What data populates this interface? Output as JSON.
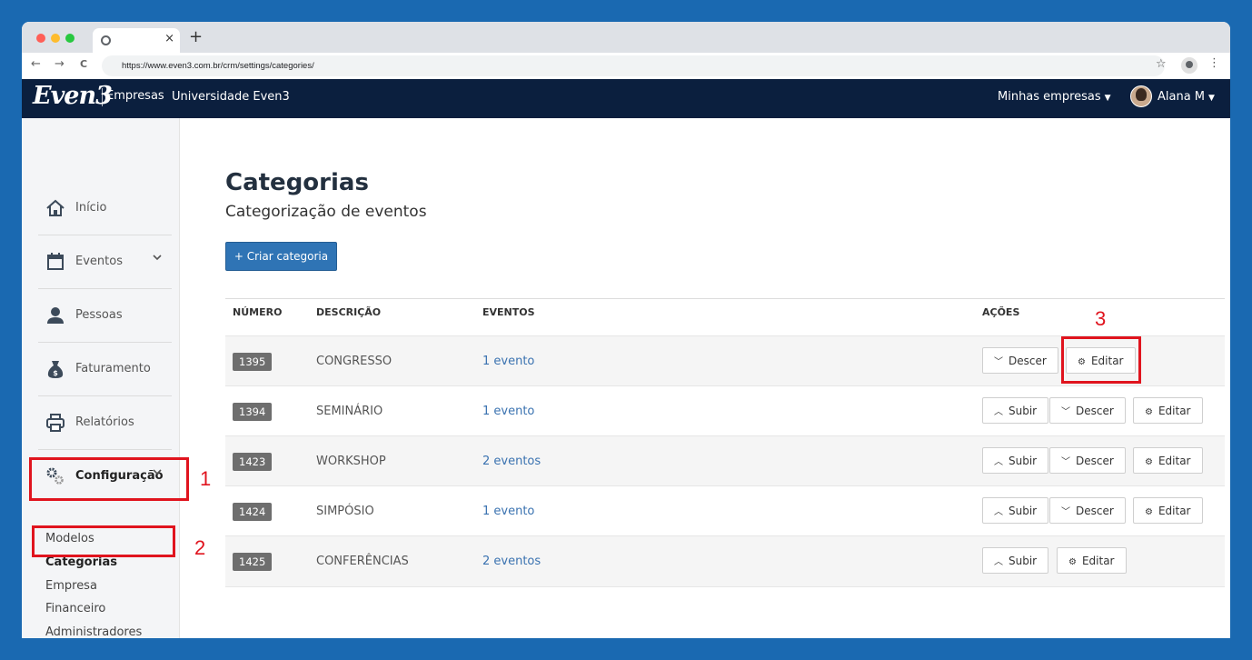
{
  "browser": {
    "url": "https://www.even3.com.br/crm/settings/categories/",
    "tab_close": "×",
    "new_tab": "+",
    "back": "←",
    "forward": "→",
    "reload": "C",
    "star": "☆",
    "kebab": "⋮",
    "dot_colors": [
      "#ff5f57",
      "#febc2e",
      "#28c840"
    ]
  },
  "header": {
    "logo": "Even3",
    "brand_sub": "Empresas",
    "org": "Universidade Even3",
    "menu_companies": "Minhas empresas",
    "user": "Alana M",
    "caret": "▼"
  },
  "sidebar": {
    "items": [
      {
        "label": "Início",
        "icon": "home-icon"
      },
      {
        "label": "Eventos",
        "icon": "calendar-icon"
      },
      {
        "label": "Pessoas",
        "icon": "person-icon"
      },
      {
        "label": "Faturamento",
        "icon": "money-bag-icon"
      },
      {
        "label": "Relatórios",
        "icon": "printer-icon"
      },
      {
        "label": "Configuração",
        "icon": "gears-icon"
      }
    ],
    "chevron": "⌄",
    "submenu": [
      "Modelos",
      "Categorias",
      "Empresa",
      "Financeiro",
      "Administradores"
    ]
  },
  "page": {
    "title": "Categorias",
    "subtitle": "Categorização de eventos",
    "create_button": "+ Criar categoria"
  },
  "table": {
    "headers": [
      "NÚMERO",
      "DESCRIÇÃO",
      "EVENTOS",
      "AÇÕES"
    ],
    "rows": [
      {
        "num": "1395",
        "desc": "CONGRESSO",
        "events": "1 evento"
      },
      {
        "num": "1394",
        "desc": "SEMINÁRIO",
        "events": "1 evento"
      },
      {
        "num": "1423",
        "desc": "WORKSHOP",
        "events": "2 eventos"
      },
      {
        "num": "1424",
        "desc": "SIMPÓSIO",
        "events": "1 evento"
      },
      {
        "num": "1425",
        "desc": "CONFERÊNCIAS",
        "events": "2 eventos"
      }
    ],
    "actions": {
      "up": "Subir",
      "down": "Descer",
      "edit": "Editar",
      "up_glyph": "︿",
      "down_glyph": "﹀",
      "edit_glyph": "⚙"
    }
  },
  "annotations": {
    "one": "1",
    "two": "2",
    "three": "3",
    "color": "#e0141e"
  }
}
